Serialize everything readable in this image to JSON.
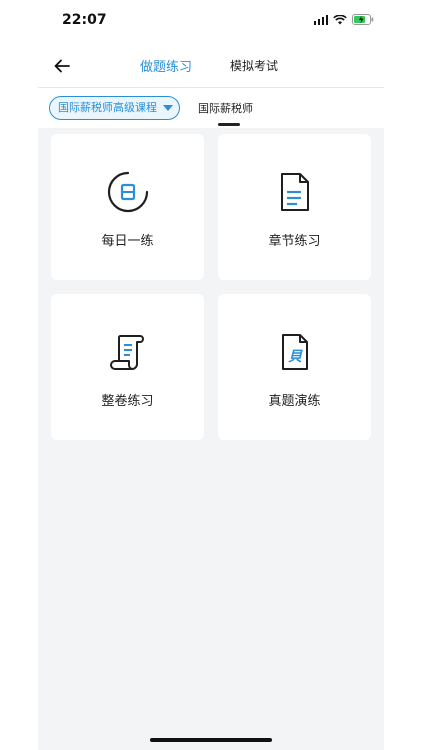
{
  "status_bar": {
    "time": "22:07"
  },
  "header": {
    "tabs": [
      {
        "label": "做题练习",
        "active": true
      },
      {
        "label": "模拟考试",
        "active": false
      }
    ]
  },
  "filter": {
    "course": "国际薪税师高级课程",
    "sub_tab": "国际薪税师"
  },
  "cards": [
    {
      "label": "每日一练",
      "icon": "daily-practice-icon"
    },
    {
      "label": "章节练习",
      "icon": "chapter-document-icon"
    },
    {
      "label": "整卷练习",
      "icon": "scroll-paper-icon"
    },
    {
      "label": "真题演练",
      "icon": "exam-document-icon"
    }
  ],
  "colors": {
    "accent": "#2a8fd6",
    "background": "#f3f4f6",
    "card": "#ffffff"
  }
}
